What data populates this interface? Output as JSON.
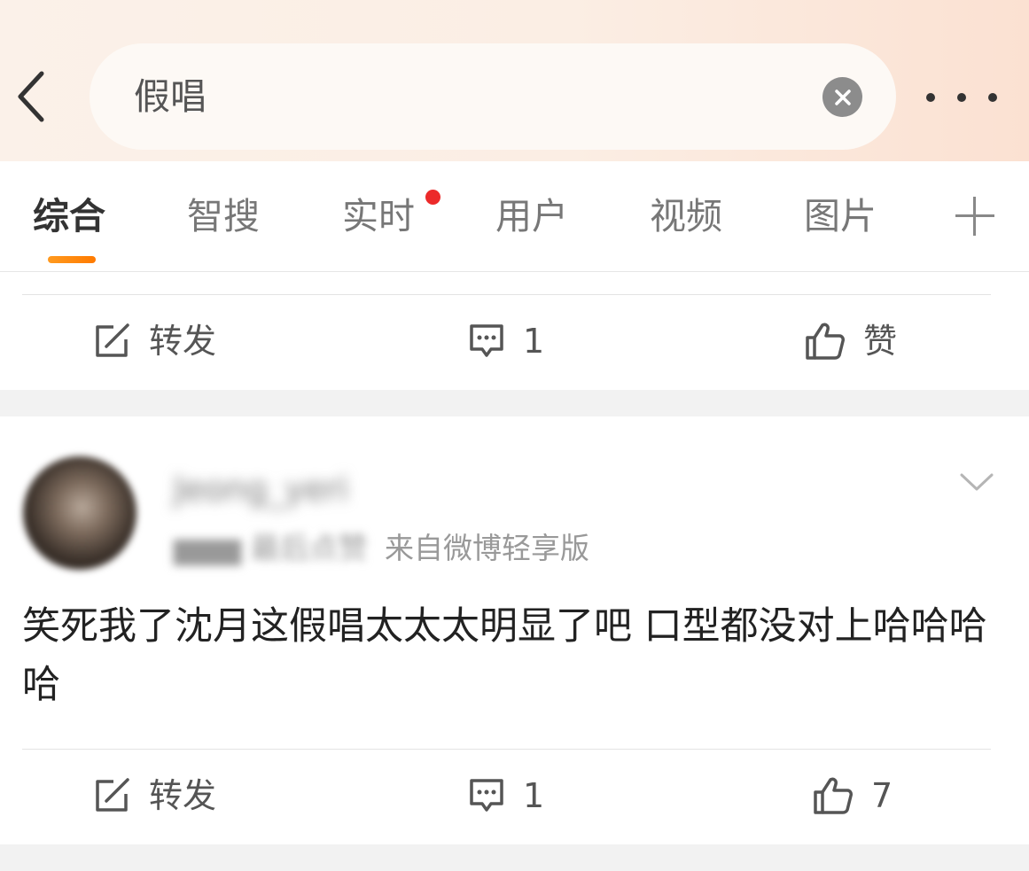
{
  "header": {
    "search_value": "假唱",
    "back_icon": "chevron-left-icon",
    "clear_icon": "close-icon",
    "more_icon": "more-horizontal-icon"
  },
  "tabs": [
    {
      "label": "综合",
      "active": true
    },
    {
      "label": "智搜",
      "active": false
    },
    {
      "label": "实时",
      "active": false,
      "badge": "red-dot"
    },
    {
      "label": "用户",
      "active": false
    },
    {
      "label": "视频",
      "active": false
    },
    {
      "label": "图片",
      "active": false
    }
  ],
  "tabs_add_icon": "plus-icon",
  "colors": {
    "accent": "#ff8200",
    "badge": "#ec2a2a"
  },
  "post_prev": {
    "repost_label": "转发",
    "comment_count": "1",
    "like_label": "赞"
  },
  "post": {
    "source": "来自微博轻享版",
    "text": "笑死我了沈月这假唱太太太明显了吧 口型都没对上哈哈哈哈",
    "repost_label": "转发",
    "comment_count": "1",
    "like_count": "7"
  }
}
